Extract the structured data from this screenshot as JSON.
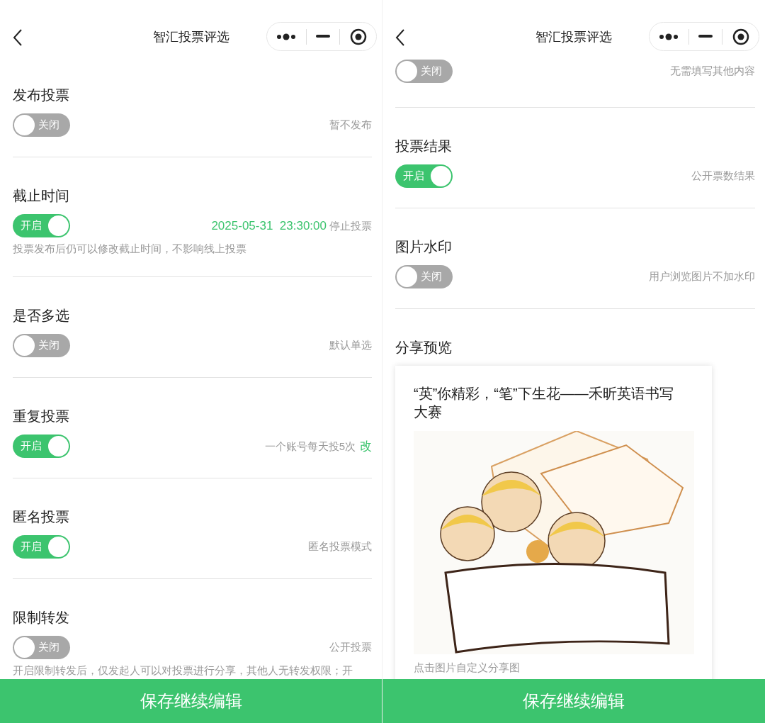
{
  "screens": [
    {
      "nav": {
        "title": "智汇投票评选"
      },
      "sections": [
        {
          "title": "发布投票",
          "toggle": {
            "on": false,
            "label": "关闭"
          },
          "status": "暂不发布"
        },
        {
          "title": "截止时间",
          "toggle": {
            "on": true,
            "label": "开启"
          },
          "value": "2025-05-31  23:30:00",
          "status": "停止投票",
          "note": "投票发布后仍可以修改截止时间，不影响线上投票"
        },
        {
          "title": "是否多选",
          "toggle": {
            "on": false,
            "label": "关闭"
          },
          "status": "默认单选"
        },
        {
          "title": "重复投票",
          "toggle": {
            "on": true,
            "label": "开启"
          },
          "status": "一个账号每天投5次",
          "action": "改"
        },
        {
          "title": "匿名投票",
          "toggle": {
            "on": true,
            "label": "开启"
          },
          "status": "匿名投票模式"
        },
        {
          "title": "限制转发",
          "toggle": {
            "on": false,
            "label": "关闭"
          },
          "status": "公开投票",
          "note": "开启限制转发后，仅发起人可以对投票进行分享，其他人无转发权限；开"
        }
      ],
      "save_button": "保存继续编辑"
    },
    {
      "nav": {
        "title": "智汇投票评选"
      },
      "sections": [
        {
          "toggle": {
            "on": false,
            "label": "关闭"
          },
          "status": "无需填写其他内容"
        },
        {
          "title": "投票结果",
          "toggle": {
            "on": true,
            "label": "开启"
          },
          "status": "公开票数结果"
        },
        {
          "title": "图片水印",
          "toggle": {
            "on": false,
            "label": "关闭"
          },
          "status": "用户浏览图片不加水印"
        }
      ],
      "share_preview": {
        "title": "分享预览",
        "card_title": "“英”你精彩，“笔”下生花——禾昕英语书写大赛",
        "caption": "点击图片自定义分享图"
      },
      "save_button": "保存继续编辑"
    }
  ]
}
